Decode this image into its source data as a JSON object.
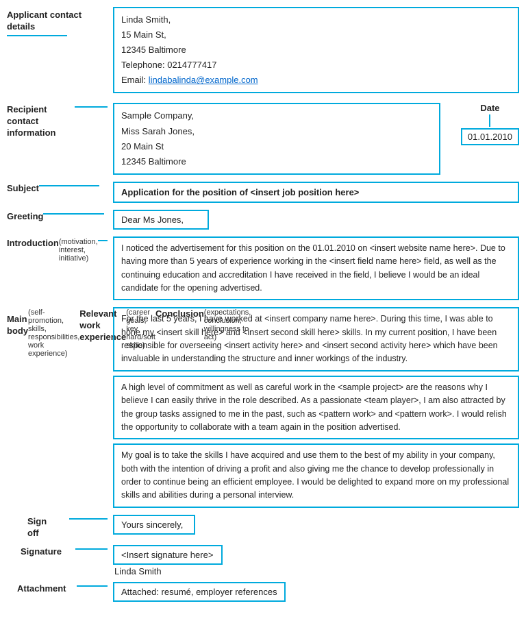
{
  "sections": {
    "applicant": {
      "label": "Applicant contact details",
      "content": {
        "name": "Linda Smith,",
        "address1": "15 Main St,",
        "city": "12345 Baltimore",
        "telephone": "Telephone: 0214777417",
        "email_prefix": "Email: ",
        "email": "lindabalinda@example.com"
      }
    },
    "recipient": {
      "label": "Recipient contact information",
      "content": {
        "company": "Sample Company,",
        "contact": "Miss Sarah Jones,",
        "address": "20 Main St",
        "city": "12345 Baltimore"
      }
    },
    "date": {
      "label": "Date",
      "value": "01.01.2010"
    },
    "subject": {
      "label": "Subject",
      "content": "Application for the position of <insert job position here>"
    },
    "greeting": {
      "label": "Greeting",
      "content": "Dear Ms Jones,"
    },
    "introduction": {
      "label": "Introduction",
      "sub": "(motivation, interest, initiative)",
      "content": "I noticed the advertisement for this position on the 01.01.2010 on <insert website name here>. Due to having more than 5 years of experience working in the <insert field name here> field, as well as the continuing education and accreditation I have received in the field, I believe I would be an ideal candidate for the opening advertised."
    },
    "main_body": {
      "label": "Main body",
      "sub": "(self-promotion, skills, responsibilities, work experience)",
      "paragraphs": [
        "For the last 5 years, I have worked at <insert company name here>. During this time, I was able to hone my <insert skill here> and <insert second skill here> skills. In my current position, I have been responsible for overseeing <insert activity here> and <insert second activity here> which have been invaluable in understanding the structure and inner workings of the industry.",
        "A high level of commitment as well as careful work in the <sample project> are the reasons why I believe I can easily thrive in the role described. As a passionate <team player>, I am also attracted by the group tasks assigned to me in the past, such as <pattern work> and <pattern work>. I would relish the opportunity to collaborate with a team again in the position advertised.",
        "My goal is to take the skills I have acquired and use them to the best of my ability in your company, both with the intention of driving a profit and also giving me the chance to develop professionally in order to continue being an efficient employee. I would be delighted to expand more on my professional skills and abilities during a personal interview."
      ]
    },
    "relevant_work": {
      "label": "Relevant work experience",
      "sub": "(career goals, key hard/soft skills)"
    },
    "conclusion": {
      "label": "Conclusion",
      "sub": "(expectations, conclusion, willingness to act)"
    },
    "signoff": {
      "label": "Sign off",
      "content": "Yours sincerely,"
    },
    "signature": {
      "label": "Signature",
      "placeholder": "<Insert signature here>",
      "name": "Linda Smith"
    },
    "attachment": {
      "label": "Attachment",
      "content": "Attached: resumé, employer references"
    }
  },
  "colors": {
    "accent": "#00aadd",
    "link": "#0066cc"
  }
}
